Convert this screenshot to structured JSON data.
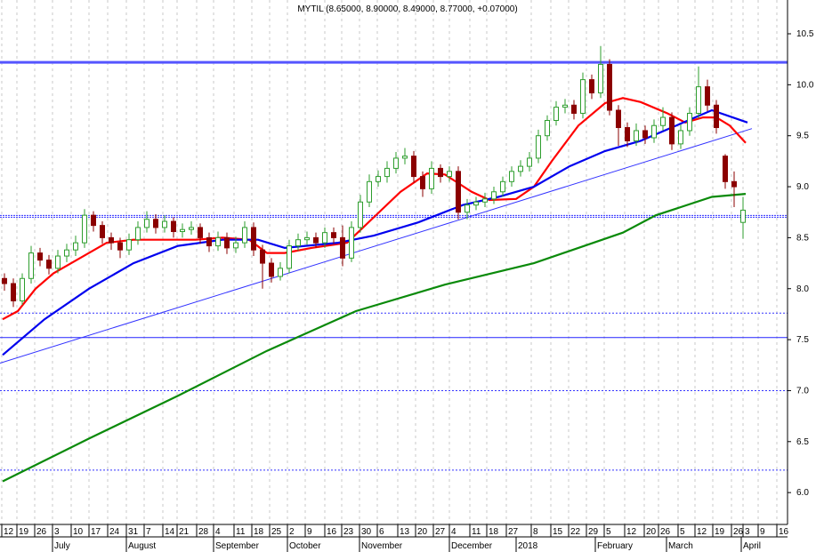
{
  "chart_data": {
    "type": "candlestick",
    "title": "MYTIL (8.65000, 8.90000, 8.49000, 8.77000, +0.07000)",
    "ylim": [
      5.75,
      10.85
    ],
    "y_ticks": [
      "6.0",
      "6.5",
      "7.0",
      "7.5",
      "8.0",
      "8.5",
      "9.0",
      "9.5",
      "10.0",
      "10.5"
    ],
    "grid": "dotted vertical at weekly ticks",
    "colors": {
      "up": "#2e9e2e",
      "up_fill": "#ffffff",
      "down": "#8b0000",
      "ma_fast": "#ff0000",
      "ma_mid": "#0000ee",
      "ma_slow": "#0a8a0a",
      "levels": "#3333ff"
    },
    "x_ticks": [
      {
        "label": "12",
        "at": 0
      },
      {
        "label": "19",
        "at": 1.7
      },
      {
        "label": "26",
        "at": 3.7
      },
      {
        "label": "3",
        "at": 5.7
      },
      {
        "label": "10",
        "at": 7.8
      },
      {
        "label": "17",
        "at": 9.8
      },
      {
        "label": "24",
        "at": 11.9
      },
      {
        "label": "31",
        "at": 14
      },
      {
        "label": "7",
        "at": 16
      },
      {
        "label": "14",
        "at": 18.1
      },
      {
        "label": "21",
        "at": 19.7
      },
      {
        "label": "28",
        "at": 21.9
      },
      {
        "label": "4",
        "at": 23.8
      },
      {
        "label": "11",
        "at": 26.1
      },
      {
        "label": "18",
        "at": 28.1
      },
      {
        "label": "25",
        "at": 30.1
      },
      {
        "label": "2",
        "at": 32.1
      },
      {
        "label": "9",
        "at": 34.1
      },
      {
        "label": "16",
        "at": 36.3
      },
      {
        "label": "23",
        "at": 38.2
      },
      {
        "label": "30",
        "at": 40.2
      },
      {
        "label": "6",
        "at": 42.2
      },
      {
        "label": "13",
        "at": 44.5
      },
      {
        "label": "20",
        "at": 46.5
      },
      {
        "label": "27",
        "at": 48.5
      },
      {
        "label": "4",
        "at": 50.3
      },
      {
        "label": "11",
        "at": 52.6
      },
      {
        "label": "18",
        "at": 54.5
      },
      {
        "label": "27",
        "at": 56.7
      },
      {
        "label": "8",
        "at": 59.5
      },
      {
        "label": "15",
        "at": 61.7
      },
      {
        "label": "22",
        "at": 63.7
      },
      {
        "label": "29",
        "at": 65.7
      },
      {
        "label": "5",
        "at": 67.7
      },
      {
        "label": "12",
        "at": 70
      },
      {
        "label": "20",
        "at": 72.2
      },
      {
        "label": "26",
        "at": 73.8
      },
      {
        "label": "5",
        "at": 76
      },
      {
        "label": "12",
        "at": 77.9
      },
      {
        "label": "19",
        "at": 79.9
      },
      {
        "label": "26",
        "at": 82
      },
      {
        "label": "3",
        "at": 83.3
      },
      {
        "label": "9",
        "at": 85
      },
      {
        "label": "16",
        "at": 87.1
      }
    ],
    "months": [
      {
        "label": "July",
        "at": 5.7
      },
      {
        "label": "August",
        "at": 14
      },
      {
        "label": "September",
        "at": 23.8
      },
      {
        "label": "October",
        "at": 32.1
      },
      {
        "label": "November",
        "at": 40.2
      },
      {
        "label": "December",
        "at": 50.3
      },
      {
        "label": "2018",
        "at": 57.8
      },
      {
        "label": "February",
        "at": 66.7
      },
      {
        "label": "March",
        "at": 74.7
      },
      {
        "label": "April",
        "at": 83.1
      }
    ],
    "candles": [
      [
        8.1,
        8.15,
        7.98,
        8.05
      ],
      [
        8.05,
        8.1,
        7.82,
        7.88
      ],
      [
        7.88,
        8.15,
        7.84,
        8.1
      ],
      [
        8.1,
        8.42,
        8.05,
        8.35
      ],
      [
        8.35,
        8.4,
        8.22,
        8.28
      ],
      [
        8.28,
        8.33,
        8.14,
        8.2
      ],
      [
        8.2,
        8.38,
        8.15,
        8.32
      ],
      [
        8.32,
        8.44,
        8.26,
        8.38
      ],
      [
        8.38,
        8.52,
        8.32,
        8.45
      ],
      [
        8.45,
        8.78,
        8.4,
        8.72
      ],
      [
        8.72,
        8.76,
        8.56,
        8.62
      ],
      [
        8.62,
        8.66,
        8.44,
        8.5
      ],
      [
        8.5,
        8.55,
        8.38,
        8.45
      ],
      [
        8.45,
        8.5,
        8.3,
        8.38
      ],
      [
        8.38,
        8.54,
        8.33,
        8.48
      ],
      [
        8.48,
        8.66,
        8.43,
        8.6
      ],
      [
        8.6,
        8.76,
        8.55,
        8.68
      ],
      [
        8.68,
        8.73,
        8.54,
        8.6
      ],
      [
        8.6,
        8.72,
        8.55,
        8.66
      ],
      [
        8.66,
        8.7,
        8.5,
        8.56
      ],
      [
        8.56,
        8.64,
        8.5,
        8.58
      ],
      [
        8.58,
        8.66,
        8.53,
        8.6
      ],
      [
        8.6,
        8.64,
        8.44,
        8.5
      ],
      [
        8.5,
        8.55,
        8.36,
        8.42
      ],
      [
        8.42,
        8.56,
        8.37,
        8.5
      ],
      [
        8.5,
        8.55,
        8.34,
        8.4
      ],
      [
        8.4,
        8.51,
        8.35,
        8.45
      ],
      [
        8.45,
        8.66,
        8.4,
        8.6
      ],
      [
        8.6,
        8.65,
        8.32,
        8.38
      ],
      [
        8.38,
        8.43,
        8.0,
        8.25
      ],
      [
        8.25,
        8.3,
        8.06,
        8.12
      ],
      [
        8.12,
        8.26,
        8.08,
        8.2
      ],
      [
        8.2,
        8.48,
        8.15,
        8.42
      ],
      [
        8.42,
        8.54,
        8.37,
        8.48
      ],
      [
        8.48,
        8.56,
        8.43,
        8.5
      ],
      [
        8.5,
        8.55,
        8.4,
        8.45
      ],
      [
        8.45,
        8.6,
        8.4,
        8.55
      ],
      [
        8.55,
        8.6,
        8.44,
        8.5
      ],
      [
        8.5,
        8.62,
        8.22,
        8.3
      ],
      [
        8.3,
        8.66,
        8.26,
        8.6
      ],
      [
        8.6,
        8.92,
        8.55,
        8.85
      ],
      [
        8.85,
        9.12,
        8.8,
        9.05
      ],
      [
        9.05,
        9.16,
        9.0,
        9.1
      ],
      [
        9.1,
        9.25,
        9.04,
        9.18
      ],
      [
        9.18,
        9.34,
        9.13,
        9.28
      ],
      [
        9.28,
        9.38,
        9.22,
        9.3
      ],
      [
        9.3,
        9.35,
        9.04,
        9.1
      ],
      [
        9.1,
        9.15,
        8.9,
        8.98
      ],
      [
        8.98,
        9.25,
        8.93,
        9.18
      ],
      [
        9.18,
        9.22,
        9.04,
        9.1
      ],
      [
        9.1,
        9.2,
        9.05,
        9.15
      ],
      [
        9.15,
        9.2,
        8.68,
        8.75
      ],
      [
        8.75,
        8.88,
        8.68,
        8.82
      ],
      [
        8.82,
        8.9,
        8.77,
        8.85
      ],
      [
        8.85,
        8.94,
        8.8,
        8.88
      ],
      [
        8.88,
        9.0,
        8.83,
        8.95
      ],
      [
        8.95,
        9.1,
        8.9,
        9.05
      ],
      [
        9.05,
        9.2,
        9.0,
        9.15
      ],
      [
        9.15,
        9.26,
        9.1,
        9.2
      ],
      [
        9.2,
        9.34,
        9.15,
        9.28
      ],
      [
        9.28,
        9.56,
        9.23,
        9.5
      ],
      [
        9.5,
        9.7,
        9.45,
        9.65
      ],
      [
        9.65,
        9.84,
        9.6,
        9.78
      ],
      [
        9.78,
        9.86,
        9.72,
        9.8
      ],
      [
        9.8,
        9.85,
        9.66,
        9.72
      ],
      [
        9.72,
        10.12,
        9.67,
        10.05
      ],
      [
        10.05,
        10.1,
        9.86,
        9.92
      ],
      [
        9.92,
        10.38,
        9.87,
        10.2
      ],
      [
        10.2,
        10.25,
        9.7,
        9.75
      ],
      [
        9.75,
        9.8,
        9.4,
        9.58
      ],
      [
        9.58,
        9.63,
        9.39,
        9.45
      ],
      [
        9.45,
        9.62,
        9.4,
        9.55
      ],
      [
        9.55,
        9.6,
        9.42,
        9.48
      ],
      [
        9.48,
        9.66,
        9.43,
        9.6
      ],
      [
        9.6,
        9.78,
        9.55,
        9.68
      ],
      [
        9.68,
        9.73,
        9.36,
        9.42
      ],
      [
        9.42,
        9.61,
        9.37,
        9.55
      ],
      [
        9.55,
        9.78,
        9.5,
        9.72
      ],
      [
        9.72,
        10.18,
        9.67,
        9.98
      ],
      [
        9.98,
        10.05,
        9.74,
        9.8
      ],
      [
        9.8,
        9.85,
        9.52,
        9.58
      ],
      [
        9.3,
        9.32,
        8.98,
        9.05
      ],
      [
        9.05,
        9.15,
        8.8,
        9.0
      ],
      [
        8.65,
        8.9,
        8.49,
        8.77
      ]
    ],
    "series": [
      {
        "name": "ma_fast",
        "color_key": "ma_fast",
        "points": [
          [
            -0.2,
            7.7
          ],
          [
            1.5,
            7.78
          ],
          [
            3.5,
            8.0
          ],
          [
            5.5,
            8.15
          ],
          [
            7.5,
            8.25
          ],
          [
            9.5,
            8.35
          ],
          [
            11.5,
            8.45
          ],
          [
            14.5,
            8.48
          ],
          [
            17.5,
            8.48
          ],
          [
            21.5,
            8.48
          ],
          [
            24.5,
            8.5
          ],
          [
            27.5,
            8.48
          ],
          [
            29.5,
            8.35
          ],
          [
            31.5,
            8.35
          ],
          [
            34.5,
            8.4
          ],
          [
            38.5,
            8.45
          ],
          [
            41.5,
            8.7
          ],
          [
            44.5,
            8.95
          ],
          [
            47.5,
            9.13
          ],
          [
            49.5,
            9.12
          ],
          [
            52.5,
            8.95
          ],
          [
            54.5,
            8.87
          ],
          [
            57.5,
            8.88
          ],
          [
            59.5,
            9.0
          ],
          [
            61.5,
            9.25
          ],
          [
            64.5,
            9.6
          ],
          [
            67.5,
            9.82
          ],
          [
            69.5,
            9.87
          ],
          [
            71.5,
            9.83
          ],
          [
            74.5,
            9.72
          ],
          [
            76.5,
            9.63
          ],
          [
            78.5,
            9.68
          ],
          [
            80,
            9.68
          ],
          [
            81.5,
            9.6
          ],
          [
            83.3,
            9.43
          ]
        ]
      },
      {
        "name": "ma_mid",
        "color_key": "ma_mid",
        "points": [
          [
            -0.2,
            7.35
          ],
          [
            4.5,
            7.7
          ],
          [
            9.5,
            8.0
          ],
          [
            14.5,
            8.25
          ],
          [
            19.5,
            8.42
          ],
          [
            24.5,
            8.48
          ],
          [
            28.5,
            8.48
          ],
          [
            31.5,
            8.4
          ],
          [
            37.5,
            8.45
          ],
          [
            41.5,
            8.52
          ],
          [
            46.5,
            8.65
          ],
          [
            51.5,
            8.82
          ],
          [
            55.5,
            8.9
          ],
          [
            59.5,
            9.0
          ],
          [
            63.5,
            9.2
          ],
          [
            67.5,
            9.35
          ],
          [
            71.5,
            9.45
          ],
          [
            75.5,
            9.6
          ],
          [
            79.5,
            9.75
          ],
          [
            83.5,
            9.63
          ]
        ]
      },
      {
        "name": "ma_slow",
        "color_key": "ma_slow",
        "points": [
          [
            -0.2,
            6.11
          ],
          [
            9.5,
            6.53
          ],
          [
            19.5,
            6.95
          ],
          [
            29.5,
            7.39
          ],
          [
            39.5,
            7.78
          ],
          [
            49.5,
            8.04
          ],
          [
            59.5,
            8.25
          ],
          [
            69.5,
            8.55
          ],
          [
            73.2,
            8.72
          ],
          [
            79.5,
            8.9
          ],
          [
            83.3,
            8.93
          ]
        ]
      }
    ],
    "trendline": [
      [
        -0.5,
        7.27
      ],
      [
        84,
        9.57
      ]
    ],
    "levels": [
      {
        "value": 10.22,
        "style": "thick"
      },
      {
        "value": 8.71,
        "style": "double-dotted"
      },
      {
        "value": 7.76,
        "style": "dotted"
      },
      {
        "value": 7.52,
        "style": "solid"
      },
      {
        "value": 7.0,
        "style": "dotted"
      },
      {
        "value": 6.22,
        "style": "dotted"
      }
    ]
  }
}
